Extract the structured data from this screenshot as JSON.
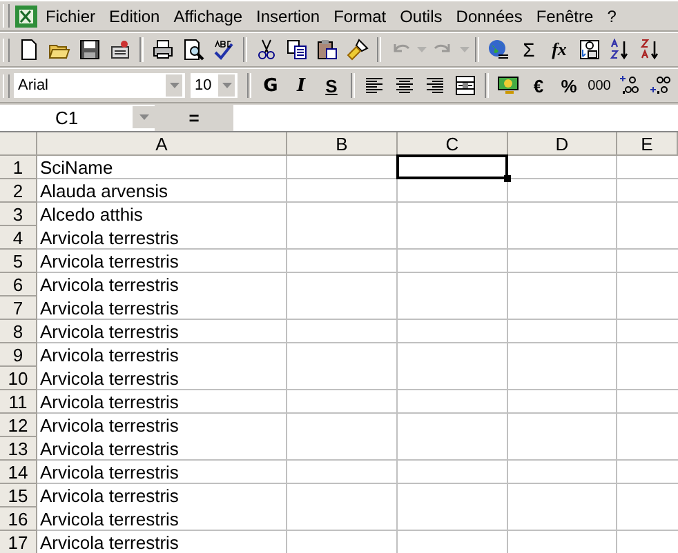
{
  "menu_bar": {
    "items": [
      "Fichier",
      "Edition",
      "Affichage",
      "Insertion",
      "Format",
      "Outils",
      "Données",
      "Fenêtre",
      "?"
    ]
  },
  "standard_toolbar": {
    "undo": {
      "disabled": true
    },
    "redo": {
      "disabled": true
    },
    "sum": "Σ",
    "function": "fx"
  },
  "format_toolbar": {
    "font": "Arial",
    "size": "10",
    "bold": "G",
    "italic": "I",
    "underline": "S",
    "euro": "€",
    "percent": "%",
    "thousands": "000"
  },
  "formula_bar": {
    "name_box": "C1",
    "equals": "="
  },
  "sheet": {
    "columns": [
      {
        "label": "A",
        "selected": false
      },
      {
        "label": "B",
        "selected": false
      },
      {
        "label": "C",
        "selected": true
      },
      {
        "label": "D",
        "selected": false
      },
      {
        "label": "E",
        "selected": false
      }
    ],
    "rows": [
      {
        "number": "1",
        "selected": true,
        "cells": [
          "SciName"
        ]
      },
      {
        "number": "2",
        "selected": false,
        "cells": [
          "Alauda arvensis"
        ]
      },
      {
        "number": "3",
        "selected": false,
        "cells": [
          "Alcedo atthis"
        ]
      },
      {
        "number": "4",
        "selected": false,
        "cells": [
          "Arvicola terrestris"
        ]
      },
      {
        "number": "5",
        "selected": false,
        "cells": [
          "Arvicola terrestris"
        ]
      },
      {
        "number": "6",
        "selected": false,
        "cells": [
          "Arvicola terrestris"
        ]
      },
      {
        "number": "7",
        "selected": false,
        "cells": [
          "Arvicola terrestris"
        ]
      },
      {
        "number": "8",
        "selected": false,
        "cells": [
          "Arvicola terrestris"
        ]
      },
      {
        "number": "9",
        "selected": false,
        "cells": [
          "Arvicola terrestris"
        ]
      },
      {
        "number": "10",
        "selected": false,
        "cells": [
          "Arvicola terrestris"
        ]
      },
      {
        "number": "11",
        "selected": false,
        "cells": [
          "Arvicola terrestris"
        ]
      },
      {
        "number": "12",
        "selected": false,
        "cells": [
          "Arvicola terrestris"
        ]
      },
      {
        "number": "13",
        "selected": false,
        "cells": [
          "Arvicola terrestris"
        ]
      },
      {
        "number": "14",
        "selected": false,
        "cells": [
          "Arvicola terrestris"
        ]
      },
      {
        "number": "15",
        "selected": false,
        "cells": [
          "Arvicola terrestris"
        ]
      },
      {
        "number": "16",
        "selected": false,
        "cells": [
          "Arvicola terrestris"
        ]
      },
      {
        "number": "17",
        "selected": false,
        "cells": [
          "Arvicola terrestris"
        ]
      }
    ]
  }
}
